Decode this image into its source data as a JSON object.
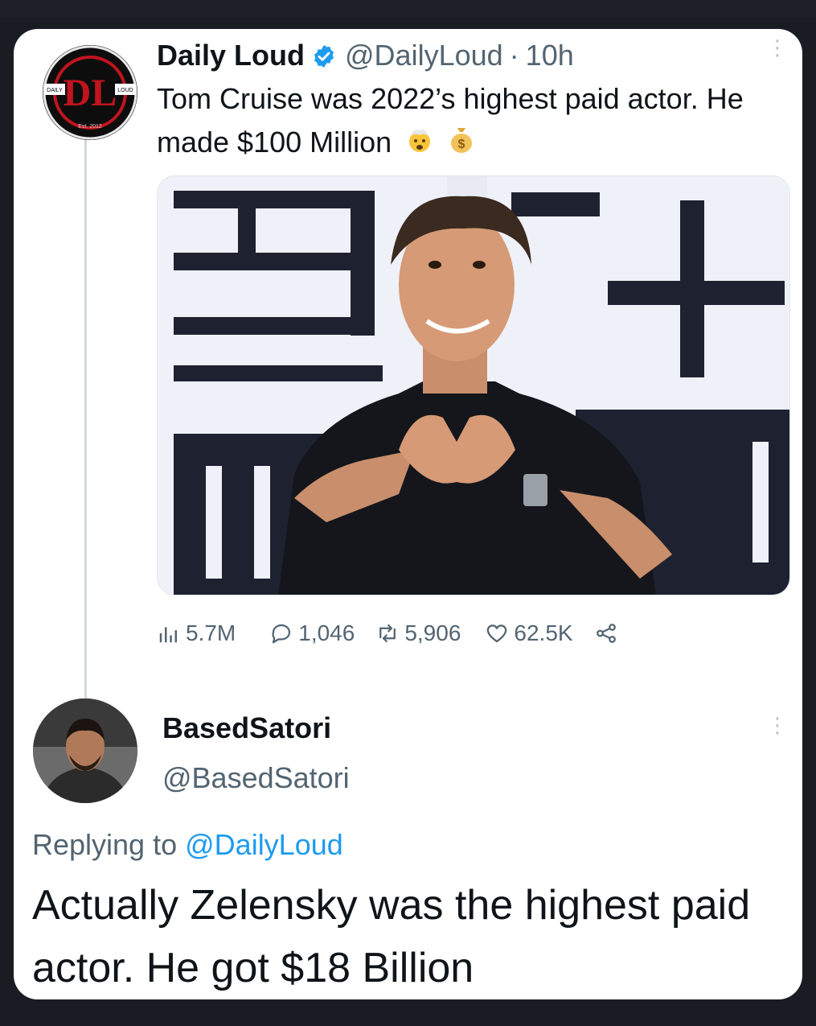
{
  "tweet": {
    "author_name": "Daily Loud",
    "author_handle": "@DailyLoud",
    "separator": "·",
    "time": "10h",
    "text": "Tom Cruise was 2022’s highest paid actor. He made $100 Million",
    "avatar_logo": "DL",
    "avatar_text_left": "DAILY",
    "avatar_text_right": "LOUD",
    "avatar_text_est": "Est. 2012",
    "emojis": [
      "exploding-head-emoji",
      "money-bag-emoji"
    ],
    "money_bag_symbol": "$",
    "stats": {
      "views": "5.7M",
      "replies": "1,046",
      "retweets": "5,906",
      "likes": "62.5K"
    },
    "icons": {
      "views": "bar-chart-icon",
      "replies": "comment-icon",
      "retweets": "retweet-icon",
      "likes": "heart-icon",
      "share": "share-icon",
      "more": "more-dots-icon",
      "verified": "verified-badge-icon"
    }
  },
  "reply": {
    "author_name": "BasedSatori",
    "author_handle": "@BasedSatori",
    "replying_to_prefix": "Replying to",
    "replying_to_handle": "@DailyLoud",
    "text": "Actually Zelensky was the highest paid actor. He got $18 Billion"
  },
  "colors": {
    "background": "#1a1c24",
    "card": "#ffffff",
    "text_primary": "#0f1419",
    "text_secondary": "#536471",
    "link": "#1d9bf0",
    "verified": "#1d9bf0",
    "logo_red": "#c0141e"
  }
}
